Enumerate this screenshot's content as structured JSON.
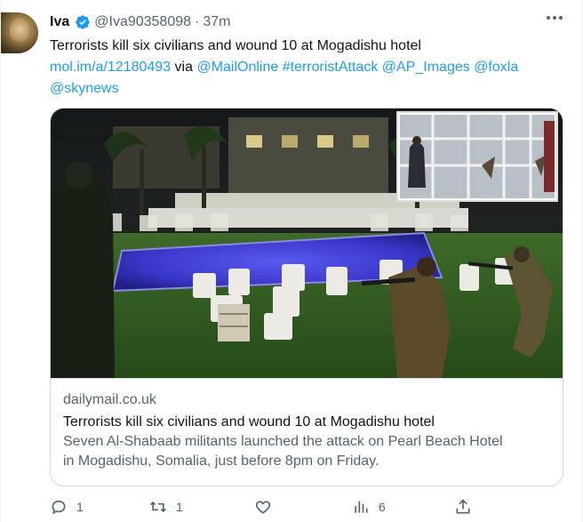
{
  "tweet": {
    "display_name": "Iva",
    "handle": "@Iva90358098",
    "separator": "·",
    "time": "37m",
    "text_line1": "Terrorists kill six civilians and wound 10 at Mogadishu hotel",
    "link_url": "mol.im/a/12180493",
    "via_word": "via",
    "mention_mailonline": "@MailOnline",
    "hashtag": "#terroristAttack",
    "mention_ap": "@AP_Images",
    "mention_foxla": "@foxla",
    "mention_skynews": "@skynews"
  },
  "card": {
    "domain": "dailymail.co.uk",
    "title": "Terrorists kill six civilians and wound 10 at Mogadishu hotel",
    "description_line1": "Seven Al-Shabaab militants launched the attack on Pearl Beach Hotel",
    "description_line2": "in Mogadishu, Somalia, just before 8pm on Friday."
  },
  "actions": {
    "reply_count": "1",
    "retweet_count": "1",
    "like_count": "",
    "views_count": "6"
  },
  "colors": {
    "accent": "#1d9bf0",
    "text": "#0f1419",
    "muted": "#536471",
    "border": "#cfd9de",
    "pool": "#3f3fd0"
  },
  "icons": [
    "verified-badge-icon",
    "more-options-icon",
    "reply-icon",
    "retweet-icon",
    "like-icon",
    "views-icon",
    "share-icon"
  ]
}
